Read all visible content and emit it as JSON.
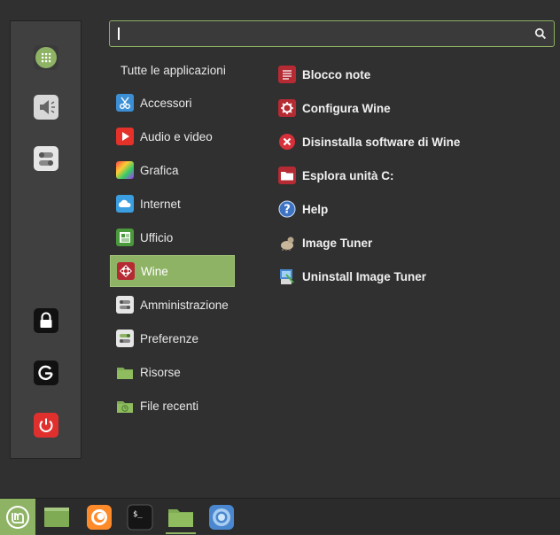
{
  "search": {
    "value": "",
    "placeholder": ""
  },
  "categories_header": "Tutte le applicazioni",
  "categories": [
    {
      "label": "Accessori",
      "icon": "scissors-icon"
    },
    {
      "label": "Audio e video",
      "icon": "play-icon"
    },
    {
      "label": "Grafica",
      "icon": "palette-icon"
    },
    {
      "label": "Internet",
      "icon": "cloud-icon"
    },
    {
      "label": "Ufficio",
      "icon": "office-icon"
    },
    {
      "label": "Wine",
      "icon": "wine-icon",
      "selected": true
    },
    {
      "label": "Amministrazione",
      "icon": "toggle-icon"
    },
    {
      "label": "Preferenze",
      "icon": "settings-toggle-icon"
    },
    {
      "label": "Risorse",
      "icon": "folder-icon"
    },
    {
      "label": "File recenti",
      "icon": "clock-folder-icon"
    }
  ],
  "apps": [
    {
      "label": "Blocco note",
      "icon": "notepad-icon"
    },
    {
      "label": "Configura Wine",
      "icon": "wine-config-icon"
    },
    {
      "label": "Disinstalla software di Wine",
      "icon": "uninstall-icon"
    },
    {
      "label": "Esplora unità C:",
      "icon": "drive-folder-icon"
    },
    {
      "label": "Help",
      "icon": "help-icon"
    },
    {
      "label": "Image Tuner",
      "icon": "image-tuner-icon"
    },
    {
      "label": "Uninstall Image Tuner",
      "icon": "uninstall-image-tuner-icon"
    }
  ],
  "sidebar": [
    {
      "name": "software-manager",
      "icon": "grid-icon",
      "color": "#8fb365"
    },
    {
      "name": "sound-settings",
      "icon": "speaker-icon",
      "color": "#d8d8d8"
    },
    {
      "name": "system-settings",
      "icon": "toggle-icon",
      "color": "#d8d8d8"
    },
    {
      "name": "lock-screen",
      "icon": "lock-icon",
      "color": "#111111"
    },
    {
      "name": "logout",
      "icon": "logout-icon",
      "color": "#111111"
    },
    {
      "name": "quit",
      "icon": "power-icon",
      "color": "#e0302e"
    }
  ],
  "taskbar": [
    {
      "name": "menu",
      "icon": "mint-logo-icon"
    },
    {
      "name": "show-desktop",
      "icon": "desktop-icon"
    },
    {
      "name": "firefox",
      "icon": "firefox-icon"
    },
    {
      "name": "terminal",
      "icon": "terminal-icon",
      "label": "$_"
    },
    {
      "name": "files",
      "icon": "folder-icon",
      "active": true
    },
    {
      "name": "chromium",
      "icon": "browser-icon"
    }
  ],
  "colors": {
    "accent": "#8fb365",
    "panel": "#303030",
    "sidebar": "#404040",
    "power": "#e0302e"
  }
}
